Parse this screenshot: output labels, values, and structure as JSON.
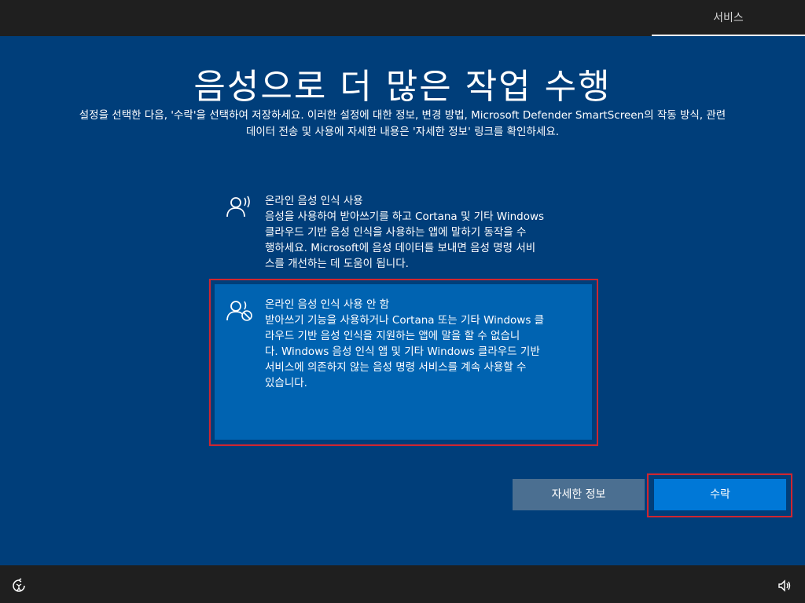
{
  "topbar": {
    "tab_label": "서비스"
  },
  "main": {
    "title": "음성으로 더 많은 작업 수행",
    "subtitle_line1": "설정을 선택한 다음, '수락'을 선택하여 저장하세요. 이러한 설정에 대한 정보, 변경 방법, Microsoft Defender SmartScreen의 작동 방식, 관련",
    "subtitle_line2": "데이터 전송 및 사용에 자세한 내용은 '자세한 정보' 링크를 확인하세요.",
    "options": [
      {
        "heading": "온라인 음성 인식 사용",
        "lines": [
          "음성을 사용하여 받아쓰기를 하고 Cortana 및 기타 Windows",
          "클라우드 기반 음성 인식을 사용하는 앱에 말하기 동작을 수",
          "행하세요. Microsoft에 음성 데이터를 보내면 음성 명령 서비",
          "스를 개선하는 데 도움이 됩니다."
        ],
        "icon": "voice-icon",
        "selected": false
      },
      {
        "heading": "온라인 음성 인식 사용 안 함",
        "lines": [
          "받아쓰기 기능을 사용하거나 Cortana 또는 기타 Windows 클",
          "라우드 기반 음성 인식을 지원하는 앱에 말을 할 수 없습니",
          "다. Windows 음성 인식 앱 및 기타 Windows 클라우드 기반",
          "서비스에 의존하지 않는 음성 명령 서비스를 계속 사용할 수",
          "있습니다."
        ],
        "icon": "voice-off-icon",
        "selected": true
      }
    ]
  },
  "buttons": {
    "more_info": "자세한 정보",
    "accept": "수락"
  },
  "colors": {
    "background": "#003e7a",
    "selected_option": "#0063b1",
    "accept_button": "#0078d7",
    "secondary_button": "#4b6f91",
    "highlight_outline": "#d0262f",
    "bar": "#1f1f1f"
  },
  "bottombar": {
    "left_icon": "accessibility-icon",
    "right_icon": "volume-icon"
  }
}
